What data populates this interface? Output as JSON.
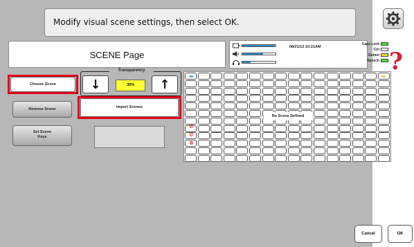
{
  "instruction": "Modify visual scene settings, then select OK.",
  "page_title": "SCENE Page",
  "status": {
    "datetime": "08/21/12 10:21AM",
    "keys": [
      {
        "label": "Caps Lock",
        "color": "#44dd33"
      },
      {
        "label": "Ctrl",
        "color": "#ffffff"
      },
      {
        "label": "Output",
        "color": "#eedd22"
      },
      {
        "label": "Speech",
        "color": "#44dd33"
      }
    ],
    "levels": {
      "battery": 0.98,
      "volume": 0.62,
      "headphone": 0.25
    }
  },
  "buttons": {
    "choose_scene": "Choose Scene",
    "remove_scene": "Remove Scene",
    "set_scene_keys_line1": "Set Scene",
    "set_scene_keys_line2": "Keys",
    "import_scenes": "Import Scenes",
    "cancel": "Cancel",
    "ok": "OK"
  },
  "transparency": {
    "label": "Transparency",
    "value": "30%",
    "down_arrow": "↓",
    "up_arrow": "↑"
  },
  "grid": {
    "empty_message": "No Scene Defined",
    "columns": 16,
    "rows": 12
  },
  "help_glyph": "?",
  "colors": {
    "highlight_frame": "#e2001a",
    "transparency_value_bg": "#ffff33",
    "level_bar": "#2f8fd1"
  }
}
